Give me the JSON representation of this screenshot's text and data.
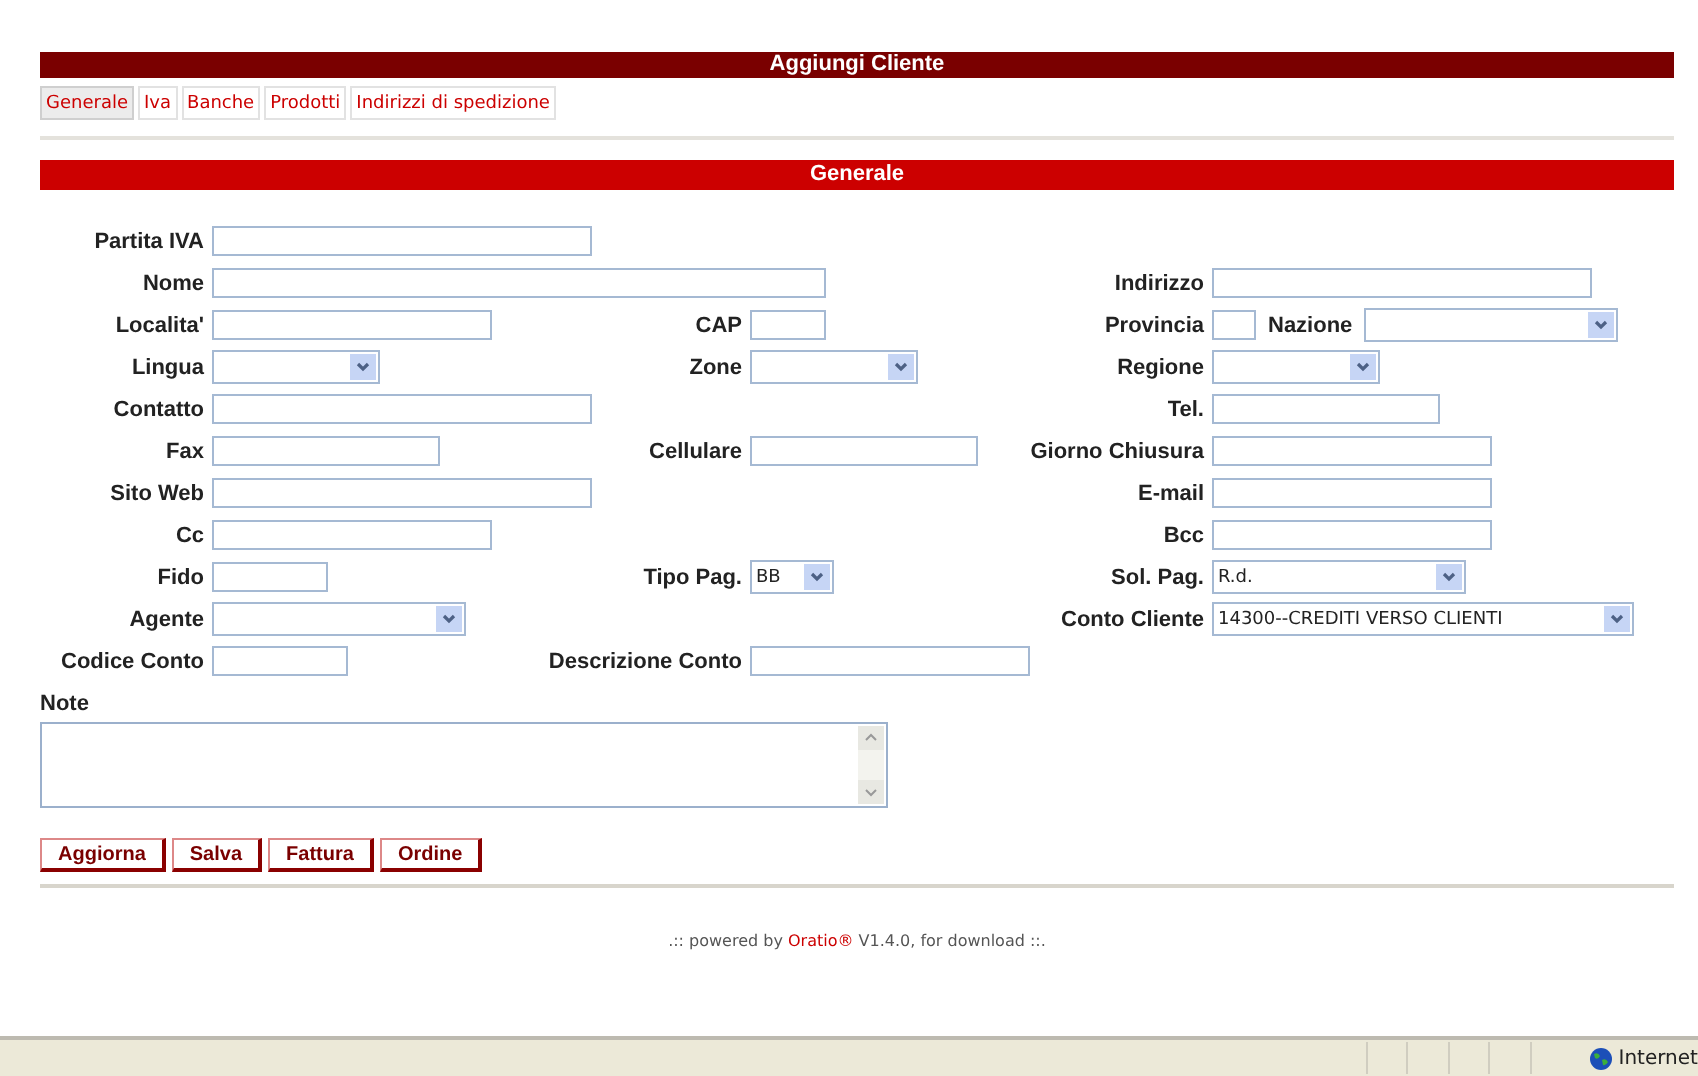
{
  "title": "Aggiungi Cliente",
  "tabs": [
    {
      "label": "Generale",
      "selected": true
    },
    {
      "label": "Iva",
      "selected": false
    },
    {
      "label": "Banche",
      "selected": false
    },
    {
      "label": "Prodotti",
      "selected": false
    },
    {
      "label": "Indirizzi di spedizione",
      "selected": false
    }
  ],
  "section_title": "Generale",
  "rows": [
    {
      "left": {
        "label": "Partita IVA",
        "kind": "input"
      }
    },
    {
      "left": {
        "label": "Nome",
        "kind": "input"
      },
      "right": {
        "label": "Indirizzo",
        "kind": "input"
      }
    },
    {
      "left": {
        "label": "Localita'",
        "kind": "input"
      },
      "middle": {
        "label": "CAP",
        "kind": "input"
      },
      "right": {
        "label": "Provincia",
        "kind": "input",
        "extra": {
          "label": "Nazione",
          "kind": "select"
        }
      }
    },
    {
      "left": {
        "label": "Lingua",
        "kind": "select"
      },
      "middle": {
        "label": "Zone",
        "kind": "select"
      },
      "right": {
        "label": "Regione",
        "kind": "select"
      }
    },
    {
      "left": {
        "label": "Contatto",
        "kind": "input"
      },
      "right": {
        "label": "Tel.",
        "kind": "input"
      }
    },
    {
      "left": {
        "label": "Fax",
        "kind": "input"
      },
      "middle": {
        "label": "Cellulare",
        "kind": "input"
      },
      "right": {
        "label": "Giorno Chiusura",
        "kind": "input"
      }
    },
    {
      "left": {
        "label": "Sito Web",
        "kind": "input"
      },
      "right": {
        "label": "E-mail",
        "kind": "input"
      }
    },
    {
      "left": {
        "label": "Cc",
        "kind": "input"
      },
      "right": {
        "label": "Bcc",
        "kind": "input"
      }
    },
    {
      "left": {
        "label": "Fido",
        "kind": "input"
      },
      "middle": {
        "label": "Tipo Pag.",
        "kind": "select",
        "value": "BB"
      },
      "right": {
        "label": "Sol. Pag.",
        "kind": "select",
        "value": "R.d."
      }
    },
    {
      "left": {
        "label": "Agente",
        "kind": "select"
      },
      "right": {
        "label": "Conto Cliente",
        "kind": "select",
        "value": "14300--CREDITI VERSO CLIENTI"
      }
    },
    {
      "left": {
        "label": "Codice Conto",
        "kind": "input"
      },
      "middle": {
        "label": "Descrizione Conto",
        "kind": "input"
      }
    }
  ],
  "note": {
    "label": "Note"
  },
  "buttons": [
    "Aggiorna",
    "Salva",
    "Fattura",
    "Ordine"
  ],
  "footer": {
    "before": ".:: powered by ",
    "brand": "Oratio®",
    "after": " V1.4.0, for download ::."
  },
  "status_bar": {
    "zone": "Internet"
  }
}
